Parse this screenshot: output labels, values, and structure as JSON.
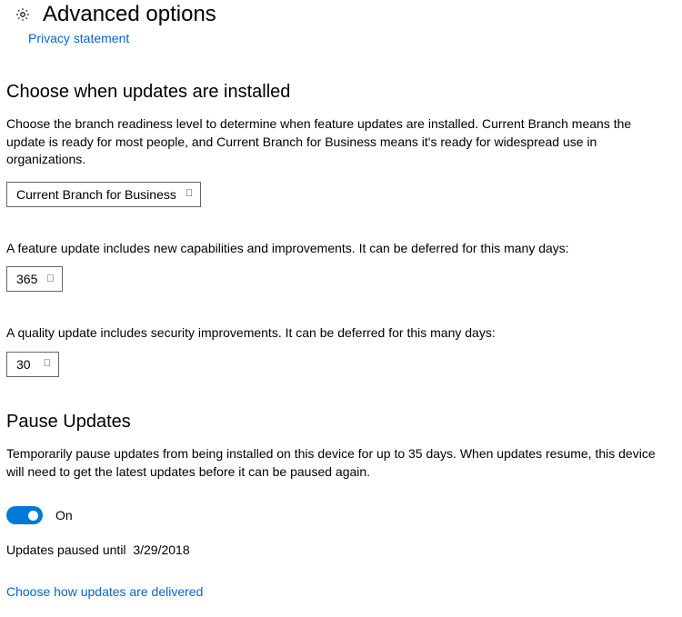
{
  "header": {
    "title": "Advanced options",
    "privacy_link": "Privacy statement"
  },
  "section1": {
    "heading": "Choose when updates are installed",
    "description": "Choose the branch readiness level to determine when feature updates are installed. Current Branch means the update is ready for most people, and Current Branch for Business means it's ready for widespread use in organizations.",
    "branch_dropdown": "Current Branch for Business",
    "feature_update_label": "A feature update includes new capabilities and improvements. It can be deferred for this many days:",
    "feature_update_days": "365",
    "quality_update_label": "A quality update includes security improvements. It can be deferred for this many days:",
    "quality_update_days": "30"
  },
  "section2": {
    "heading": "Pause Updates",
    "description": "Temporarily pause updates from being installed on this device for up to 35 days. When updates resume, this device will need to get the latest updates before it can be paused again.",
    "toggle_state": "On",
    "paused_until_label": "Updates paused until",
    "paused_until_date": "3/29/2018",
    "delivery_link": "Choose how updates are delivered"
  }
}
